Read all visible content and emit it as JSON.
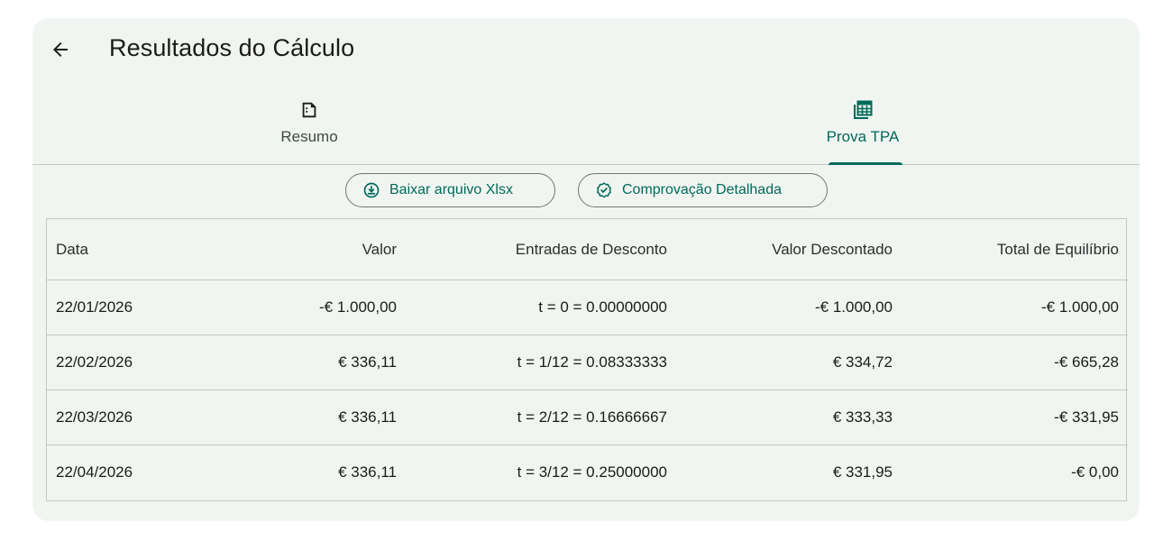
{
  "header": {
    "title": "Resultados do Cálculo",
    "back_icon": "arrow-left-icon"
  },
  "tabs": [
    {
      "label": "Resumo",
      "icon": "document-icon",
      "active": false
    },
    {
      "label": "Prova TPA",
      "icon": "table-icon",
      "active": true
    }
  ],
  "actions": {
    "download_label": "Baixar arquivo Xlsx",
    "download_icon": "download-circle-icon",
    "verify_label": "Comprovação Detalhada",
    "verify_icon": "verified-badge-icon"
  },
  "table": {
    "headers": [
      "Data",
      "Valor",
      "Entradas de Desconto",
      "Valor Descontado",
      "Total de Equilíbrio"
    ],
    "rows": [
      [
        "22/01/2026",
        "-€ 1.000,00",
        "t = 0 = 0.00000000",
        "-€ 1.000,00",
        "-€ 1.000,00"
      ],
      [
        "22/02/2026",
        "€ 336,11",
        "t = 1/12 = 0.08333333",
        "€ 334,72",
        "-€ 665,28"
      ],
      [
        "22/03/2026",
        "€ 336,11",
        "t = 2/12 = 0.16666667",
        "€ 333,33",
        "-€ 331,95"
      ],
      [
        "22/04/2026",
        "€ 336,11",
        "t = 3/12 = 0.25000000",
        "€ 331,95",
        "-€ 0,00"
      ]
    ]
  },
  "colors": {
    "accent": "#006a5a",
    "card_background": "#f1f5f1",
    "divider": "#c3c8c2"
  }
}
